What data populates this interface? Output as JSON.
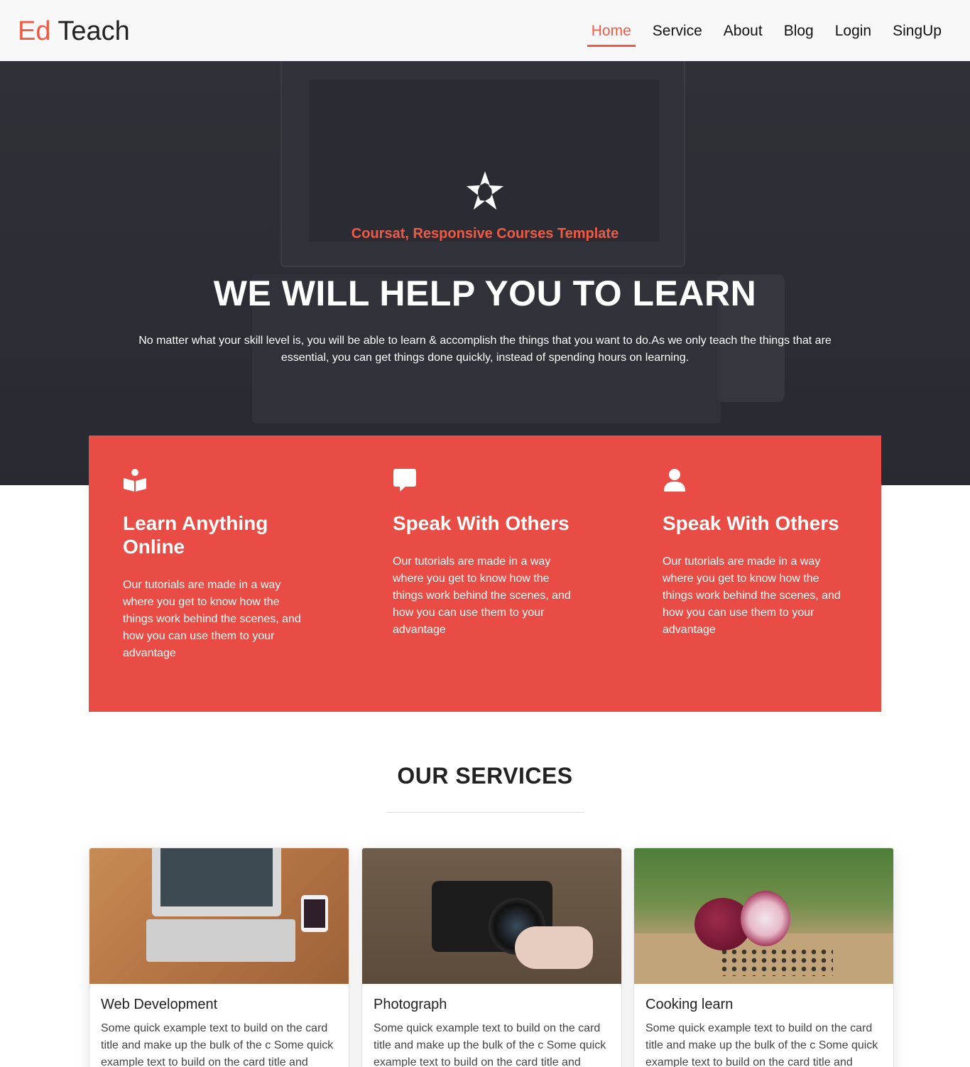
{
  "brand": {
    "first": "Ed",
    "second": "Teach"
  },
  "nav": {
    "items": [
      {
        "label": "Home",
        "active": true
      },
      {
        "label": "Service",
        "active": false
      },
      {
        "label": "About",
        "active": false
      },
      {
        "label": "Blog",
        "active": false
      },
      {
        "label": "Login",
        "active": false
      },
      {
        "label": "SingUp",
        "active": false
      }
    ]
  },
  "hero": {
    "logo_icon": "star-pinwheel-icon",
    "subtitle": "Coursat, Responsive Courses Template",
    "title": "WE WILL HELP YOU TO LEARN",
    "text": "No matter what your skill level is, you will be able to learn & accomplish the things that you want to do.As we only teach the things that are essential, you can get things done quickly, instead of spending hours on learning."
  },
  "features": [
    {
      "icon": "book-reader-icon",
      "title": "Learn Anything Online",
      "text": "Our tutorials are made in a way where you get to know how the things work behind the scenes, and how you can use them to your advantage"
    },
    {
      "icon": "chat-bubble-icon",
      "title": "Speak With Others",
      "text": "Our tutorials are made in a way where you get to know how the things work behind the scenes, and how you can use them to your advantage"
    },
    {
      "icon": "user-icon",
      "title": "Speak With Others",
      "text": "Our tutorials are made in a way where you get to know how the things work behind the scenes, and how you can use them to your advantage"
    }
  ],
  "services": {
    "title": "OUR SERVICES",
    "cards": [
      {
        "title": "Web Development",
        "text": "Some quick example text to build on the card title and make up the bulk of the c Some quick example text to build on the card title and"
      },
      {
        "title": "Photograph",
        "text": "Some quick example text to build on the card title and make up the bulk of the c Some quick example text to build on the card title and"
      },
      {
        "title": "Cooking learn",
        "text": "Some quick example text to build on the card title and make up the bulk of the c Some quick example text to build on the card title and"
      }
    ]
  },
  "colors": {
    "accent": "#f05a45",
    "feature_bg": "#e84c44",
    "navbar_bg": "#f8f8f8"
  }
}
